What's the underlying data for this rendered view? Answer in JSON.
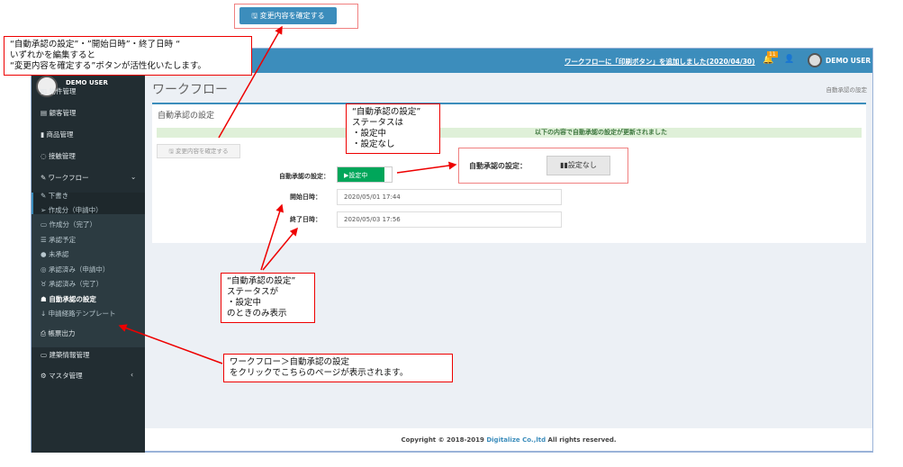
{
  "header": {
    "news_link": "ワークフローに「印刷ボタン」を追加しました(2020/04/30)",
    "notification_count": "11",
    "user_name": "DEMO USER"
  },
  "sidebar": {
    "user_name": "DEMO USER",
    "items": [
      {
        "label": "物件管理",
        "icon": "building-icon"
      },
      {
        "label": "顧客管理",
        "icon": "id-card-icon"
      },
      {
        "label": "商品管理",
        "icon": "chart-icon"
      },
      {
        "label": "接触管理",
        "icon": "chat-icon"
      },
      {
        "label": "ワークフロー",
        "icon": "edit-icon"
      },
      {
        "label": "下書き",
        "icon": "pencil-icon"
      },
      {
        "label": "作成分（申請中）",
        "icon": "send-icon"
      },
      {
        "label": "作成分（完了）",
        "icon": "inbox-icon"
      },
      {
        "label": "承認予定",
        "icon": "list-icon"
      },
      {
        "label": "未承認",
        "icon": "info-icon"
      },
      {
        "label": "承認済み（申請中）",
        "icon": "check-circle-icon"
      },
      {
        "label": "承認済み（完了）",
        "icon": "thumbs-up-icon"
      },
      {
        "label": "自動承認の設定",
        "icon": "robot-icon"
      },
      {
        "label": "申請経路テンプレート",
        "icon": "arrow-down-icon"
      },
      {
        "label": "帳票出力",
        "icon": "print-icon"
      },
      {
        "label": "建築情報管理",
        "icon": "keyboard-icon"
      },
      {
        "label": "マスタ管理",
        "icon": "gears-icon"
      }
    ]
  },
  "main": {
    "page_title": "ワークフロー",
    "breadcrumb": "自動承認の設定",
    "box_title": "自動承認の設定",
    "alert": "以下の内容で自動承認の設定が更新されました",
    "confirm_button": "変更内容を確定する",
    "auto_label": "自動承認の設定：",
    "toggle_on": "▶設定中",
    "start_label": "開始日時：",
    "start_value": "2020/05/01 17:44",
    "end_label": "終了日時：",
    "end_value": "2020/05/03 17:56"
  },
  "footer": {
    "prefix": "Copyright © 2018-2019 ",
    "company": "Digitalize Co.,ltd",
    "suffix": " All rights reserved."
  },
  "annotations": {
    "top_button": "変更内容を確定する",
    "note1": "“自動承認の設定”・”開始日時”・終了日時 “\nいずれかを編集すると\n“変更内容を確定する”ボタンが活性化いたします。",
    "note2": "“自動承認の設定”\nステータスは\n・設定中\n・設定なし",
    "off_label": "自動承認の設定：",
    "off_button": "設定なし",
    "note3": "“自動承認の設定”\nステータスが\n・設定中\nのときのみ表示",
    "note4": "ワークフロー＞自動承認の設定\nをクリックでこちらのページが表示されます。"
  },
  "colors": {
    "header": "#3c8dbc",
    "sidebar": "#222d32",
    "toggle_on": "#00a65a",
    "annotation": "#ee0000"
  }
}
